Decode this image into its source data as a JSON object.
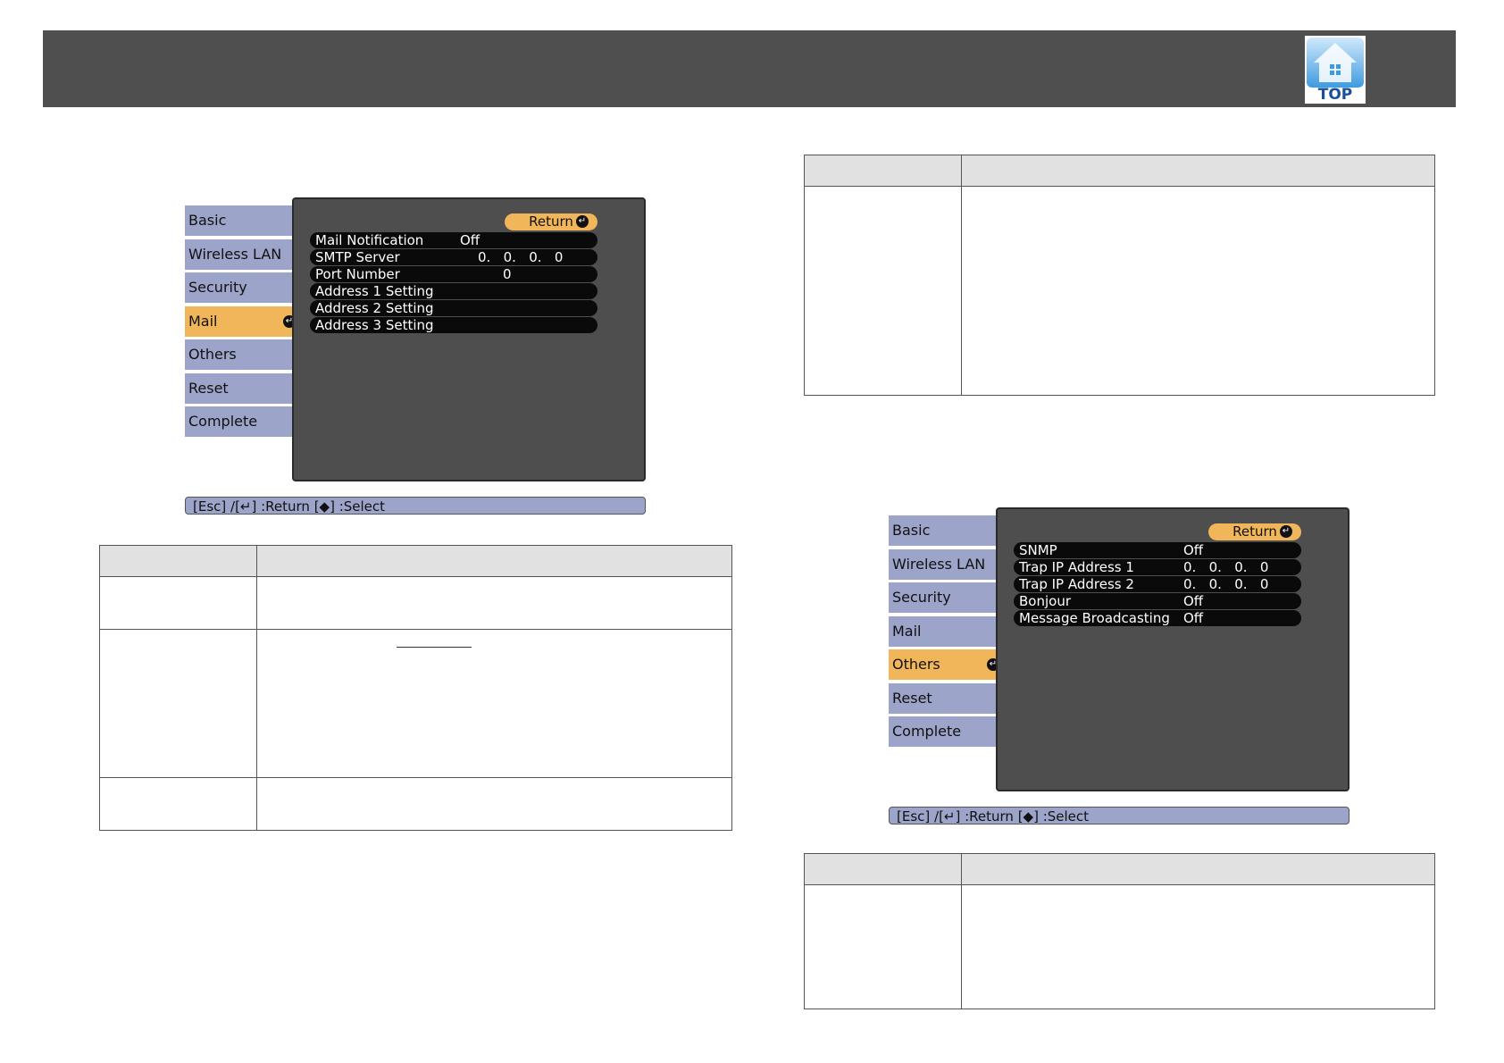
{
  "header": {
    "logo_label": "TOP"
  },
  "mail_screen": {
    "sidebar": [
      "Basic",
      "Wireless LAN",
      "Security",
      "Mail",
      "Others",
      "Reset",
      "Complete"
    ],
    "active_index": 3,
    "return_label": "Return",
    "options": [
      {
        "label": "Mail Notification",
        "value": "Off"
      },
      {
        "label": "SMTP Server",
        "value": "0.   0.   0.   0"
      },
      {
        "label": "Port Number",
        "value": "0"
      },
      {
        "label": "Address 1 Setting",
        "value": ""
      },
      {
        "label": "Address 2 Setting",
        "value": ""
      },
      {
        "label": "Address 3 Setting",
        "value": ""
      }
    ],
    "status": "[Esc] /[↵] :Return  [◆] :Select"
  },
  "others_screen": {
    "sidebar": [
      "Basic",
      "Wireless LAN",
      "Security",
      "Mail",
      "Others",
      "Reset",
      "Complete"
    ],
    "active_index": 4,
    "return_label": "Return",
    "options": [
      {
        "label": "SNMP",
        "value": "Off"
      },
      {
        "label": "Trap IP Address 1",
        "value": "0.   0.   0.   0"
      },
      {
        "label": "Trap IP Address 2",
        "value": "0.   0.   0.   0"
      },
      {
        "label": "Bonjour",
        "value": "Off"
      },
      {
        "label": "Message Broadcasting",
        "value": "Off"
      }
    ],
    "status": "[Esc] /[↵] :Return  [◆] :Select"
  }
}
